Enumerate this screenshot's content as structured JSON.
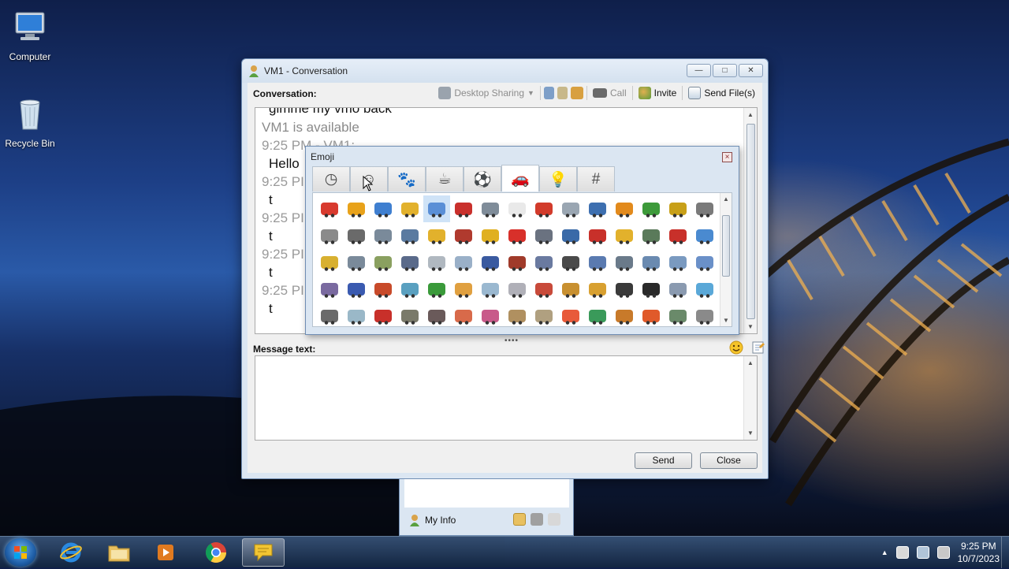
{
  "desktop": {
    "icons": [
      {
        "label": "Computer"
      },
      {
        "label": "Recycle Bin"
      }
    ]
  },
  "window": {
    "title": "VM1 - Conversation",
    "conversation_label": "Conversation:",
    "toolbar": {
      "desktop_sharing": "Desktop Sharing",
      "call": "Call",
      "invite": "Invite",
      "send_files": "Send File(s)"
    },
    "conversation": [
      {
        "kind": "msg",
        "text": "gimme my vmo back"
      },
      {
        "kind": "sys",
        "text": "VM1 is available"
      },
      {
        "kind": "hdr",
        "text": "9:25 PM - VM1:"
      },
      {
        "kind": "msg",
        "text": "Hello"
      },
      {
        "kind": "hdr",
        "text": "9:25 PI"
      },
      {
        "kind": "msg",
        "text": "t"
      },
      {
        "kind": "hdr",
        "text": "9:25 PI"
      },
      {
        "kind": "msg",
        "text": "t"
      },
      {
        "kind": "hdr",
        "text": "9:25 PI"
      },
      {
        "kind": "msg",
        "text": "t"
      },
      {
        "kind": "hdr",
        "text": "9:25 PI"
      },
      {
        "kind": "msg",
        "text": "t"
      }
    ],
    "message_label": "Message text:",
    "message_value": "",
    "send_button": "Send",
    "close_button": "Close"
  },
  "emoji_popup": {
    "title": "Emoji",
    "close": "×",
    "tabs": [
      {
        "name": "recent",
        "glyph": "◷"
      },
      {
        "name": "smileys",
        "glyph": "☺"
      },
      {
        "name": "animals",
        "glyph": "🐾"
      },
      {
        "name": "food",
        "glyph": "☕"
      },
      {
        "name": "activities",
        "glyph": "⚽"
      },
      {
        "name": "travel",
        "glyph": "🚗"
      },
      {
        "name": "objects",
        "glyph": "💡"
      },
      {
        "name": "symbols",
        "glyph": "#"
      }
    ],
    "active_tab": "travel",
    "selected_index": 4,
    "emoji_colors": [
      "#d83a2e",
      "#e8a21a",
      "#3f7fd0",
      "#e2b12c",
      "#5a8fd6",
      "#c9302c",
      "#7f8c99",
      "#e9e9e9",
      "#d23b2b",
      "#9aa6b2",
      "#3d6fb0",
      "#e28a1c",
      "#3d9a3a",
      "#c8a018",
      "#7a7a7a",
      "#8a8a8a",
      "#6a6a6a",
      "#7a8a9a",
      "#5a7aa0",
      "#e2b12c",
      "#b03a2e",
      "#e0b020",
      "#d8302a",
      "#6a7280",
      "#3a6aa8",
      "#c8302a",
      "#e2b12c",
      "#5a7a5a",
      "#c8302a",
      "#4a8ad0",
      "#d8b030",
      "#7a8a9a",
      "#8aa060",
      "#5a6a8a",
      "#b0b8c0",
      "#9ab0c8",
      "#3a5aa0",
      "#a03a2a",
      "#6a7aa0",
      "#4a4a4a",
      "#5a7ab0",
      "#6a7a8a",
      "#6a8ab0",
      "#7a9ac0",
      "#6a90c8",
      "#7a6aa0",
      "#3a5ab0",
      "#c84a2a",
      "#5aa0c0",
      "#3a9a3a",
      "#e0a040",
      "#9ab8d0",
      "#b0b0b8",
      "#c84a3a",
      "#c89030",
      "#d8a030",
      "#3a3a3a",
      "#2a2a2a",
      "#8a9ab0",
      "#5aa8d8",
      "#6a6a6a",
      "#9ab8c8",
      "#c8302a",
      "#7a7a6a",
      "#6a5a5a",
      "#d86a4a",
      "#c85a8a",
      "#b09060",
      "#b0a080",
      "#e85a3a",
      "#3a9a5a",
      "#c87a2a",
      "#e05a2a",
      "#6a8a6a",
      "#8a8a8a"
    ]
  },
  "buddy_list": {
    "my_info": "My Info"
  },
  "taskbar": {
    "apps": [
      {
        "name": "internet-explorer"
      },
      {
        "name": "file-explorer"
      },
      {
        "name": "media-player"
      },
      {
        "name": "chrome"
      },
      {
        "name": "messenger"
      }
    ],
    "time": "9:25 PM",
    "date": "10/7/2023"
  }
}
